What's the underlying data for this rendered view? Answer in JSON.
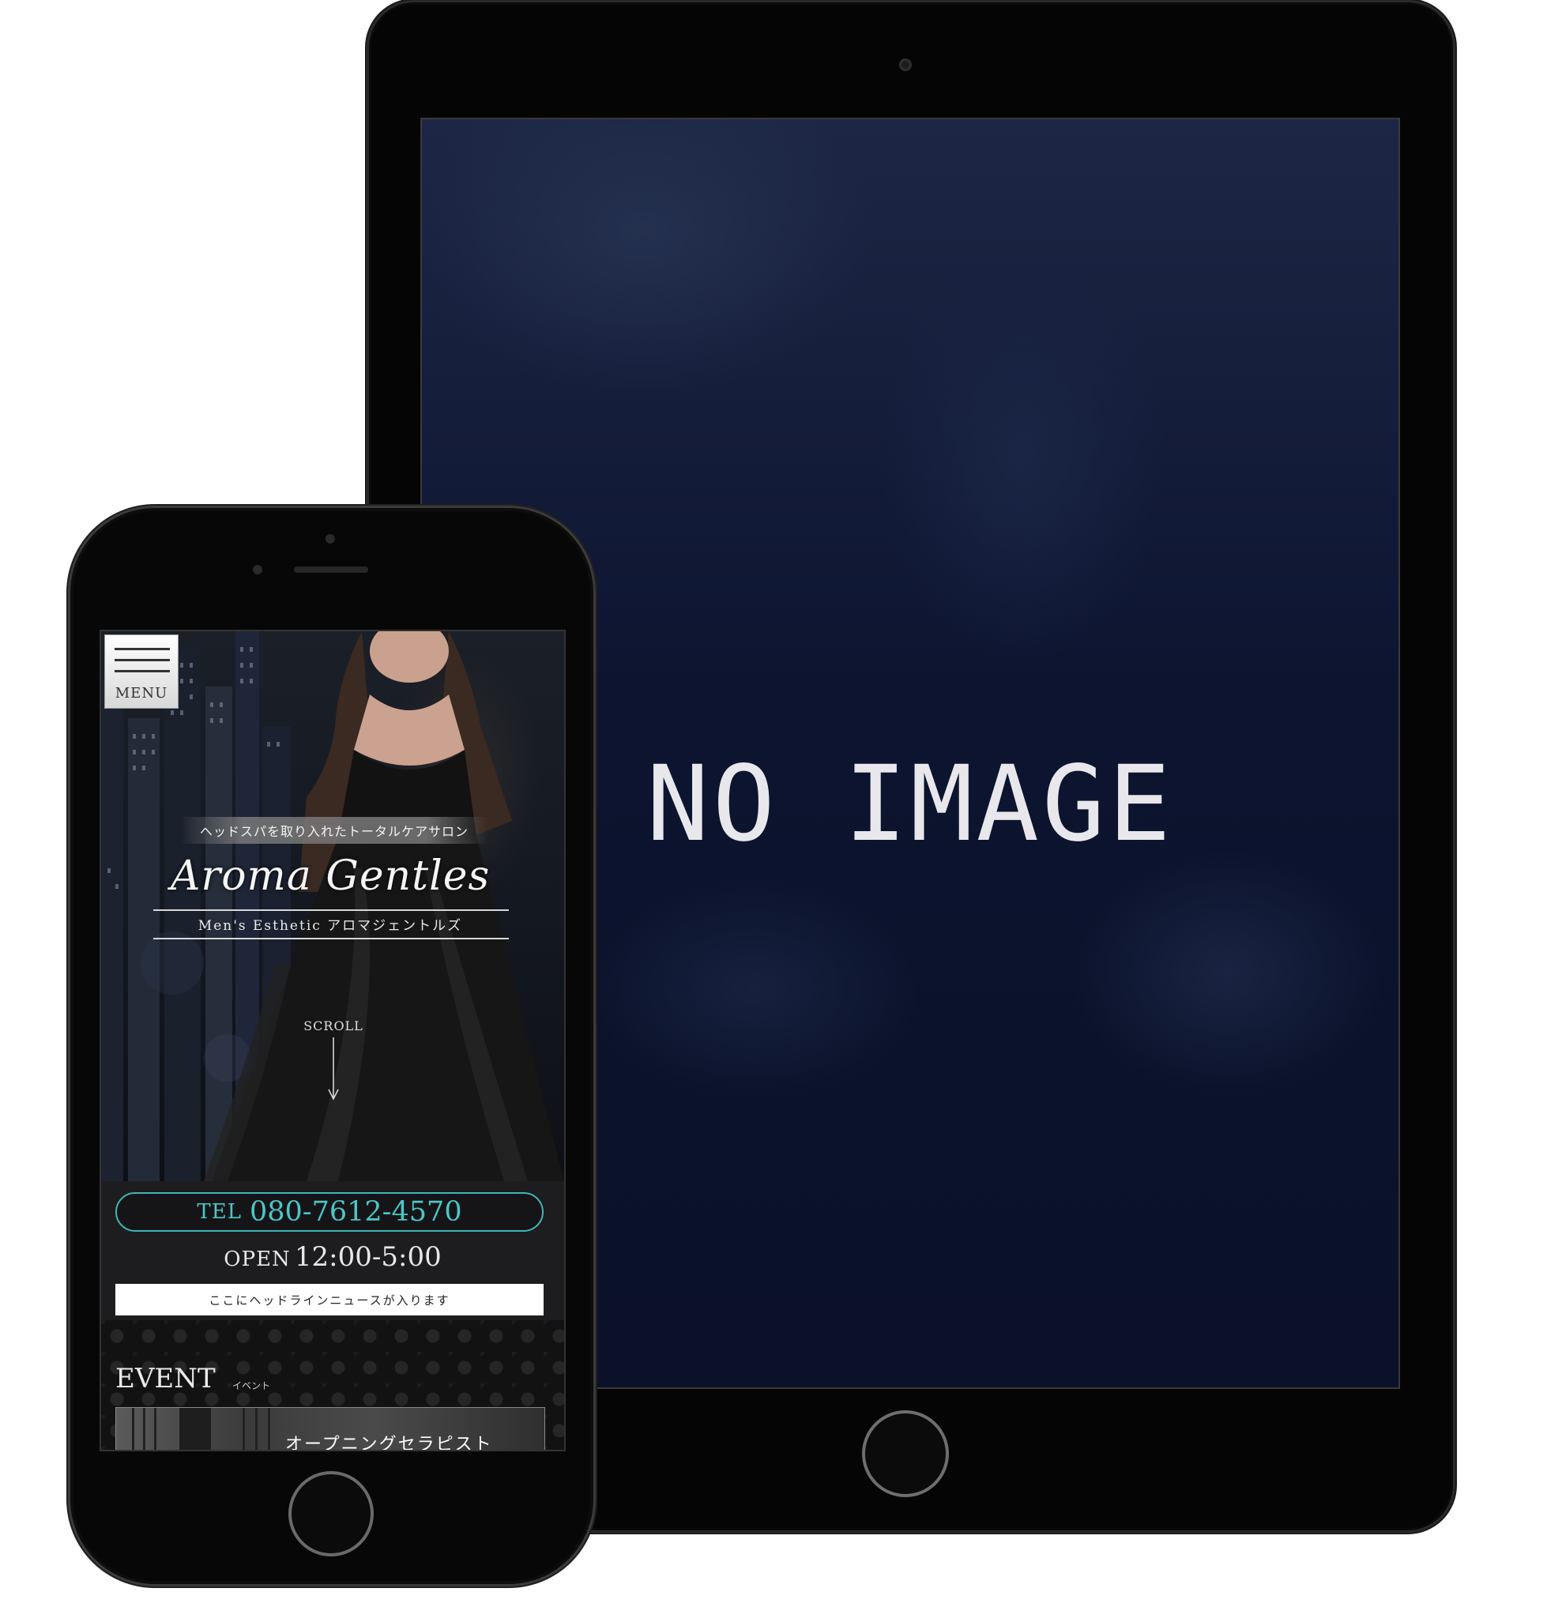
{
  "tablet": {
    "placeholder_text": "NO IMAGE"
  },
  "phone_site": {
    "menu": {
      "label": "MENU"
    },
    "hero": {
      "tagline": "ヘッドスパを取り入れたトータルケアサロン",
      "logo_name": "Aroma Gentles",
      "logo_subtitle": "Men's Esthetic アロマジェントルズ",
      "scroll_label": "SCROLL"
    },
    "contact": {
      "tel_label": "TEL",
      "tel_number": "080-7612-4570",
      "open_label": "OPEN",
      "open_time": "12:00-5:00"
    },
    "headline_news": "ここにヘッドラインニュースが入ります",
    "event": {
      "title": "EVENT",
      "subtitle": "イベント",
      "card_text": "オープニングセラピスト"
    }
  },
  "colors": {
    "accent_teal": "#4cc6c6",
    "tablet_screen": "#0c1430",
    "device_body": "#050505"
  }
}
